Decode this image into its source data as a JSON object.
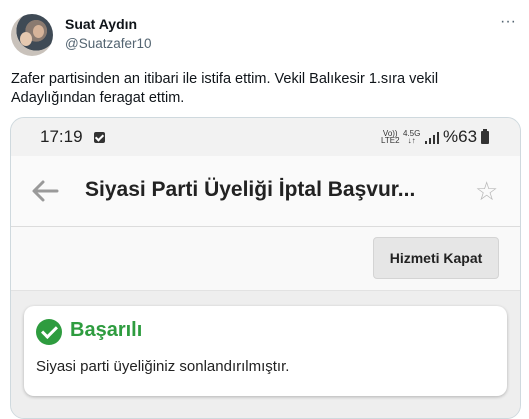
{
  "tweet": {
    "author_name": "Suat Aydın",
    "author_handle": "@Suatzafer10",
    "more_label": "···",
    "text": "Zafer partisinden an itibari ile istifa ettim. Vekil Balıkesir 1.sıra vekil Adaylığından feragat ettim."
  },
  "phone": {
    "status_bar": {
      "time": "17:19",
      "net1_top": "Vo))",
      "net1_bottom": "LTE2",
      "net2_top": "4.5G",
      "net2_bottom": "↓↑",
      "battery": "%63"
    },
    "app_bar": {
      "title": "Siyasi Parti Üyeliği İptal Başvur..."
    },
    "toolbar": {
      "close_label": "Hizmeti Kapat"
    },
    "result": {
      "title": "Başarılı",
      "message": "Siyasi parti üyeliğiniz sonlandırılmıştır."
    }
  },
  "colors": {
    "success": "#2e9c3f",
    "handle": "#536471"
  },
  "icons": [
    "more-icon",
    "checkbox-icon",
    "signal-icon",
    "battery-icon",
    "back-arrow-icon",
    "star-icon",
    "success-check-icon"
  ]
}
